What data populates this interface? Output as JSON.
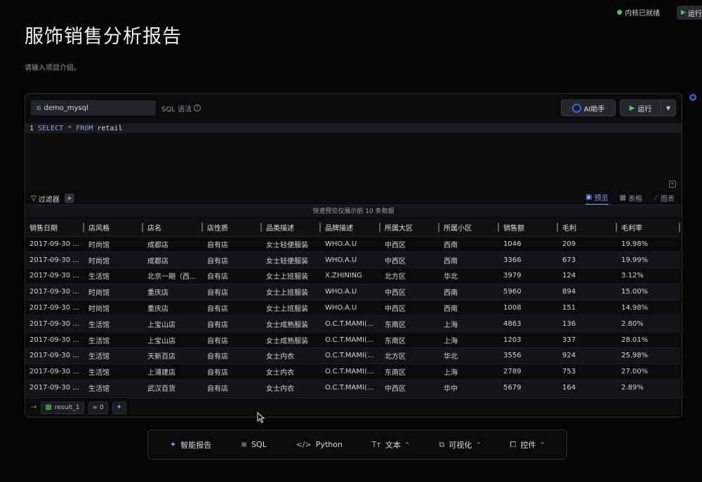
{
  "top": {
    "status": "内核已就绪",
    "run_label": "运行"
  },
  "page": {
    "title": "服饰销售分析报告",
    "intro": "请输入项目介绍。"
  },
  "cell": {
    "db_name": "demo_mysql",
    "sql_syntax": "SQL 语法",
    "ai_label": "AI助手",
    "run_label": "运行",
    "code": {
      "line_no": "1",
      "kw1": "SELECT",
      "op": "*",
      "kw2": "FROM",
      "table": "retail"
    },
    "filter_label": "过滤器",
    "tabs": {
      "preview": "预览",
      "table": "表格",
      "chart": "图表"
    },
    "preview_note": "快速预览仅展示前 10 条数据",
    "columns": [
      "销售日期",
      "店风格",
      "店名",
      "店性质",
      "品类描述",
      "品牌描述",
      "所属大区",
      "所属小区",
      "销售额",
      "毛利",
      "毛利率"
    ],
    "rows": [
      [
        "2017-09-30 ...",
        "时尚馆",
        "成都店",
        "自有店",
        "女士轻便服装",
        "WHO.A.U",
        "中西区",
        "西南",
        "1046",
        "209",
        "19.98%"
      ],
      [
        "2017-09-30 ...",
        "时尚馆",
        "成都店",
        "自有店",
        "女士轻便服装",
        "WHO.A.U",
        "中西区",
        "西南",
        "3366",
        "673",
        "19.99%"
      ],
      [
        "2017-09-30 ...",
        "生活馆",
        "北京一期（西...",
        "自有店",
        "女士上班服装",
        "X.ZHINING",
        "北方区",
        "华北",
        "3979",
        "124",
        "3.12%"
      ],
      [
        "2017-09-30 ...",
        "时尚馆",
        "重庆店",
        "自有店",
        "女士上班服装",
        "WHO.A.U",
        "中西区",
        "西南",
        "5960",
        "894",
        "15.00%"
      ],
      [
        "2017-09-30 ...",
        "时尚馆",
        "重庆店",
        "自有店",
        "女士上班服装",
        "WHO.A.U",
        "中西区",
        "西南",
        "1008",
        "151",
        "14.98%"
      ],
      [
        "2017-09-30 ...",
        "生活馆",
        "上宝山店",
        "自有店",
        "女士成熟服装",
        "O.C.T.MAMI(...",
        "东南区",
        "上海",
        "4863",
        "136",
        "2.80%"
      ],
      [
        "2017-09-30 ...",
        "生活馆",
        "上宝山店",
        "自有店",
        "女士成熟服装",
        "O.C.T.MAMI(...",
        "东南区",
        "上海",
        "1203",
        "337",
        "28.01%"
      ],
      [
        "2017-09-30 ...",
        "生活馆",
        "天新百店",
        "自有店",
        "女士内衣",
        "O.C.T.MAMI(...",
        "北方区",
        "华北",
        "3556",
        "924",
        "25.98%"
      ],
      [
        "2017-09-30 ...",
        "生活馆",
        "上浦建店",
        "自有店",
        "女士内衣",
        "O.C.T.MAMI(...",
        "东南区",
        "上海",
        "2789",
        "753",
        "27.00%"
      ],
      [
        "2017-09-30 ...",
        "生活馆",
        "武汉百货",
        "自有店",
        "女士内衣",
        "O.C.T.MAMI(...",
        "中西区",
        "华中",
        "5679",
        "164",
        "2.89%"
      ]
    ],
    "footer": {
      "result_name": "result_1",
      "link_count": "0"
    }
  },
  "bottom_bar": {
    "report": "智能报告",
    "sql": "SQL",
    "python": "Python",
    "text": "文本",
    "viz": "可视化",
    "widget": "控件"
  }
}
